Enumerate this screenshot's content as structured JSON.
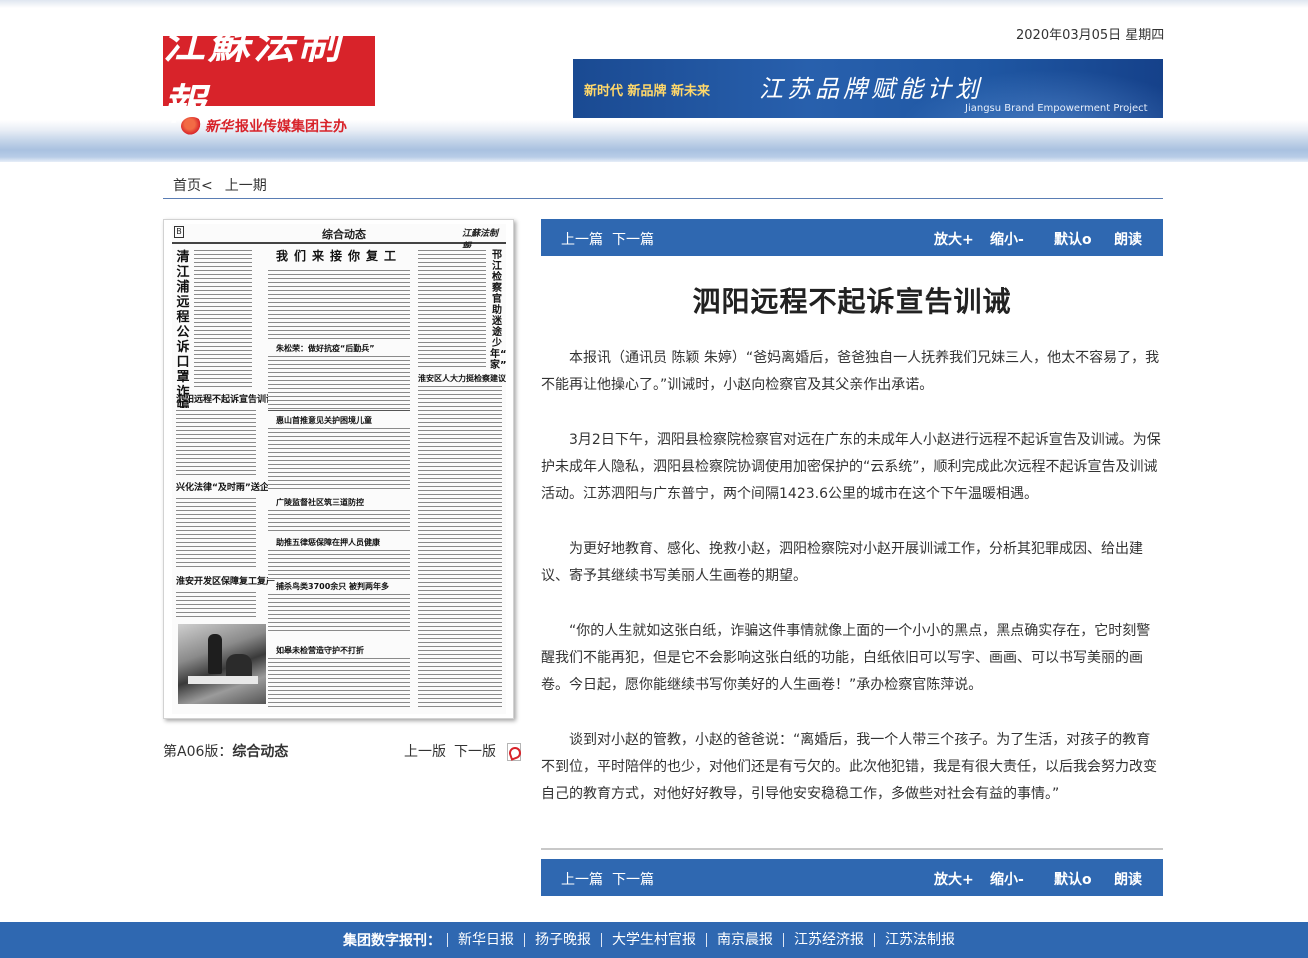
{
  "header": {
    "logo_text": "江蘇法制報",
    "sub_logo_brand": "新华",
    "sub_logo_text": "报业传媒集团主办",
    "date": "2020年03月05日  星期四",
    "banner": {
      "slogan": "新时代  新品牌  新未来",
      "title": "江苏品牌赋能计划",
      "subtitle": "Jiangsu Brand Empowerment Project"
    }
  },
  "breadcrumb": {
    "home": "首页<",
    "prev_issue": "上一期"
  },
  "paper_thumb": {
    "edition_letter": "B",
    "section": "综合动态",
    "brand": "江蘇法制報",
    "headline_main": "我们来接你复工",
    "headline_left": "清江浦远程公诉口罩诈骗案",
    "headline_right": "邗江检察官助迷途少年“回家”",
    "h1": "泗阳远程不起诉宣告训诫",
    "h2": "兴化法律“及时雨”送企业",
    "h3": "朱松荣：做好抗疫“后勤兵”",
    "h4": "淮安区人大力挺检察建议",
    "h5": "惠山首推意见关护困境儿童",
    "h6": "广陵监督社区筑三道防控",
    "h7": "助推五律惩保障在押人员健康",
    "h8": "捕杀鸟类3700余只 被判两年多",
    "h9": "淮安开发区保障复工复产",
    "h10": "如皋未检营造守护不打折"
  },
  "edition": {
    "label": "第A06版：",
    "name": "综合动态",
    "prev": "上一版",
    "next": "下一版"
  },
  "toolbar": {
    "prev": "上一篇",
    "next": "下一篇",
    "zoom_in": "放大+",
    "zoom_out": "缩小-",
    "reset": "默认o",
    "read": "朗读"
  },
  "article": {
    "title": "泗阳远程不起诉宣告训诫",
    "paragraphs": [
      "本报讯（通讯员 陈颖 朱婷）“爸妈离婚后，爸爸独自一人抚养我们兄妹三人，他太不容易了，我不能再让他操心了。”训诫时，小赵向检察官及其父亲作出承诺。",
      "3月2日下午，泗阳县检察院检察官对远在广东的未成年人小赵进行远程不起诉宣告及训诫。为保护未成年人隐私，泗阳县检察院协调使用加密保护的“云系统”，顺利完成此次远程不起诉宣告及训诫活动。江苏泗阳与广东普宁，两个间隔1423.6公里的城市在这个下午温暖相遇。",
      "为更好地教育、感化、挽救小赵，泗阳检察院对小赵开展训诫工作，分析其犯罪成因、给出建议、寄予其继续书写美丽人生画卷的期望。",
      "“你的人生就如这张白纸，诈骗这件事情就像上面的一个小小的黑点，黑点确实存在，它时刻警醒我们不能再犯，但是它不会影响这张白纸的功能，白纸依旧可以写字、画画、可以书写美丽的画卷。今日起，愿你能继续书写你美好的人生画卷！”承办检察官陈萍说。",
      "谈到对小赵的管教，小赵的爸爸说：“离婚后，我一个人带三个孩子。为了生活，对孩子的教育不到位，平时陪伴的也少，对他们还是有亏欠的。此次他犯错，我是有很大责任，以后我会努力改变自己的教育方式，对他好好教导，引导他安安稳稳工作，多做些对社会有益的事情。”"
    ]
  },
  "footer": {
    "label": "集团数字报刊：",
    "links": [
      "新华日报",
      "扬子晚报",
      "大学生村官报",
      "南京晨报",
      "江苏经济报",
      "江苏法制报"
    ]
  },
  "colors": {
    "brand_red": "#d8232a",
    "nav_blue": "#2f68b1"
  }
}
